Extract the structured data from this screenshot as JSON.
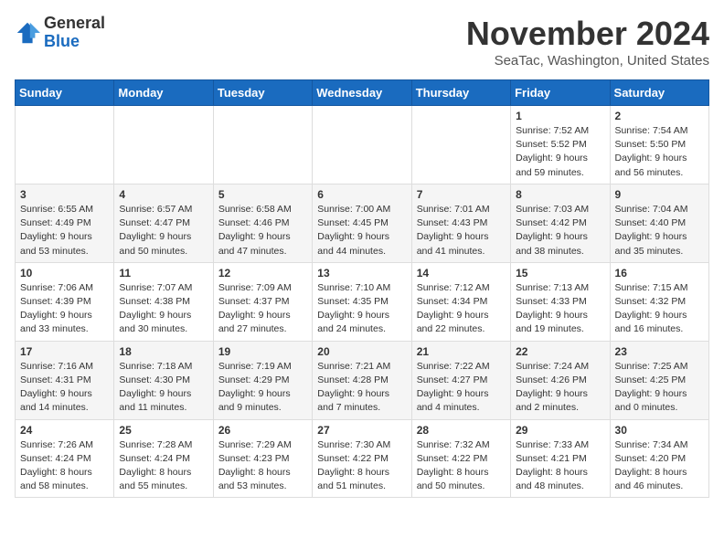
{
  "header": {
    "logo_general": "General",
    "logo_blue": "Blue",
    "month_title": "November 2024",
    "location": "SeaTac, Washington, United States"
  },
  "weekdays": [
    "Sunday",
    "Monday",
    "Tuesday",
    "Wednesday",
    "Thursday",
    "Friday",
    "Saturday"
  ],
  "weeks": [
    [
      {
        "day": "",
        "info": ""
      },
      {
        "day": "",
        "info": ""
      },
      {
        "day": "",
        "info": ""
      },
      {
        "day": "",
        "info": ""
      },
      {
        "day": "",
        "info": ""
      },
      {
        "day": "1",
        "info": "Sunrise: 7:52 AM\nSunset: 5:52 PM\nDaylight: 9 hours and 59 minutes."
      },
      {
        "day": "2",
        "info": "Sunrise: 7:54 AM\nSunset: 5:50 PM\nDaylight: 9 hours and 56 minutes."
      }
    ],
    [
      {
        "day": "3",
        "info": "Sunrise: 6:55 AM\nSunset: 4:49 PM\nDaylight: 9 hours and 53 minutes."
      },
      {
        "day": "4",
        "info": "Sunrise: 6:57 AM\nSunset: 4:47 PM\nDaylight: 9 hours and 50 minutes."
      },
      {
        "day": "5",
        "info": "Sunrise: 6:58 AM\nSunset: 4:46 PM\nDaylight: 9 hours and 47 minutes."
      },
      {
        "day": "6",
        "info": "Sunrise: 7:00 AM\nSunset: 4:45 PM\nDaylight: 9 hours and 44 minutes."
      },
      {
        "day": "7",
        "info": "Sunrise: 7:01 AM\nSunset: 4:43 PM\nDaylight: 9 hours and 41 minutes."
      },
      {
        "day": "8",
        "info": "Sunrise: 7:03 AM\nSunset: 4:42 PM\nDaylight: 9 hours and 38 minutes."
      },
      {
        "day": "9",
        "info": "Sunrise: 7:04 AM\nSunset: 4:40 PM\nDaylight: 9 hours and 35 minutes."
      }
    ],
    [
      {
        "day": "10",
        "info": "Sunrise: 7:06 AM\nSunset: 4:39 PM\nDaylight: 9 hours and 33 minutes."
      },
      {
        "day": "11",
        "info": "Sunrise: 7:07 AM\nSunset: 4:38 PM\nDaylight: 9 hours and 30 minutes."
      },
      {
        "day": "12",
        "info": "Sunrise: 7:09 AM\nSunset: 4:37 PM\nDaylight: 9 hours and 27 minutes."
      },
      {
        "day": "13",
        "info": "Sunrise: 7:10 AM\nSunset: 4:35 PM\nDaylight: 9 hours and 24 minutes."
      },
      {
        "day": "14",
        "info": "Sunrise: 7:12 AM\nSunset: 4:34 PM\nDaylight: 9 hours and 22 minutes."
      },
      {
        "day": "15",
        "info": "Sunrise: 7:13 AM\nSunset: 4:33 PM\nDaylight: 9 hours and 19 minutes."
      },
      {
        "day": "16",
        "info": "Sunrise: 7:15 AM\nSunset: 4:32 PM\nDaylight: 9 hours and 16 minutes."
      }
    ],
    [
      {
        "day": "17",
        "info": "Sunrise: 7:16 AM\nSunset: 4:31 PM\nDaylight: 9 hours and 14 minutes."
      },
      {
        "day": "18",
        "info": "Sunrise: 7:18 AM\nSunset: 4:30 PM\nDaylight: 9 hours and 11 minutes."
      },
      {
        "day": "19",
        "info": "Sunrise: 7:19 AM\nSunset: 4:29 PM\nDaylight: 9 hours and 9 minutes."
      },
      {
        "day": "20",
        "info": "Sunrise: 7:21 AM\nSunset: 4:28 PM\nDaylight: 9 hours and 7 minutes."
      },
      {
        "day": "21",
        "info": "Sunrise: 7:22 AM\nSunset: 4:27 PM\nDaylight: 9 hours and 4 minutes."
      },
      {
        "day": "22",
        "info": "Sunrise: 7:24 AM\nSunset: 4:26 PM\nDaylight: 9 hours and 2 minutes."
      },
      {
        "day": "23",
        "info": "Sunrise: 7:25 AM\nSunset: 4:25 PM\nDaylight: 9 hours and 0 minutes."
      }
    ],
    [
      {
        "day": "24",
        "info": "Sunrise: 7:26 AM\nSunset: 4:24 PM\nDaylight: 8 hours and 58 minutes."
      },
      {
        "day": "25",
        "info": "Sunrise: 7:28 AM\nSunset: 4:24 PM\nDaylight: 8 hours and 55 minutes."
      },
      {
        "day": "26",
        "info": "Sunrise: 7:29 AM\nSunset: 4:23 PM\nDaylight: 8 hours and 53 minutes."
      },
      {
        "day": "27",
        "info": "Sunrise: 7:30 AM\nSunset: 4:22 PM\nDaylight: 8 hours and 51 minutes."
      },
      {
        "day": "28",
        "info": "Sunrise: 7:32 AM\nSunset: 4:22 PM\nDaylight: 8 hours and 50 minutes."
      },
      {
        "day": "29",
        "info": "Sunrise: 7:33 AM\nSunset: 4:21 PM\nDaylight: 8 hours and 48 minutes."
      },
      {
        "day": "30",
        "info": "Sunrise: 7:34 AM\nSunset: 4:20 PM\nDaylight: 8 hours and 46 minutes."
      }
    ]
  ]
}
